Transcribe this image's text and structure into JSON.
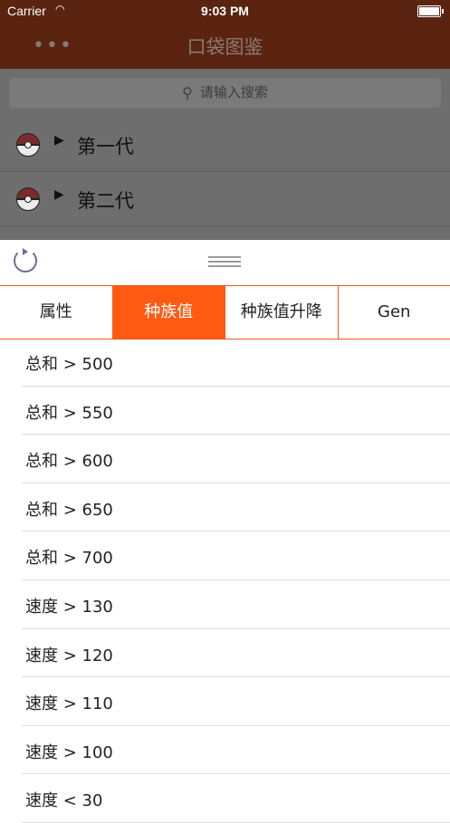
{
  "status_bar": {
    "carrier": "Carrier",
    "time": "9:03 PM"
  },
  "nav": {
    "more_icon": "more-horizontal-icon",
    "title": "口袋图鉴"
  },
  "search": {
    "placeholder": "请输入搜索"
  },
  "generations": [
    "第一代",
    "第二代"
  ],
  "sheet": {
    "tabs": [
      "属性",
      "种族值",
      "种族值升降",
      "Gen"
    ],
    "active_tab": "种族值",
    "filters": [
      "总和 > 500",
      "总和 > 550",
      "总和 > 600",
      "总和 > 650",
      "总和 > 700",
      "速度 > 130",
      "速度 > 120",
      "速度 > 110",
      "速度 > 100",
      "速度 < 30"
    ]
  },
  "colors": {
    "accent": "#ff5a12",
    "navbar": "#5a2410"
  }
}
